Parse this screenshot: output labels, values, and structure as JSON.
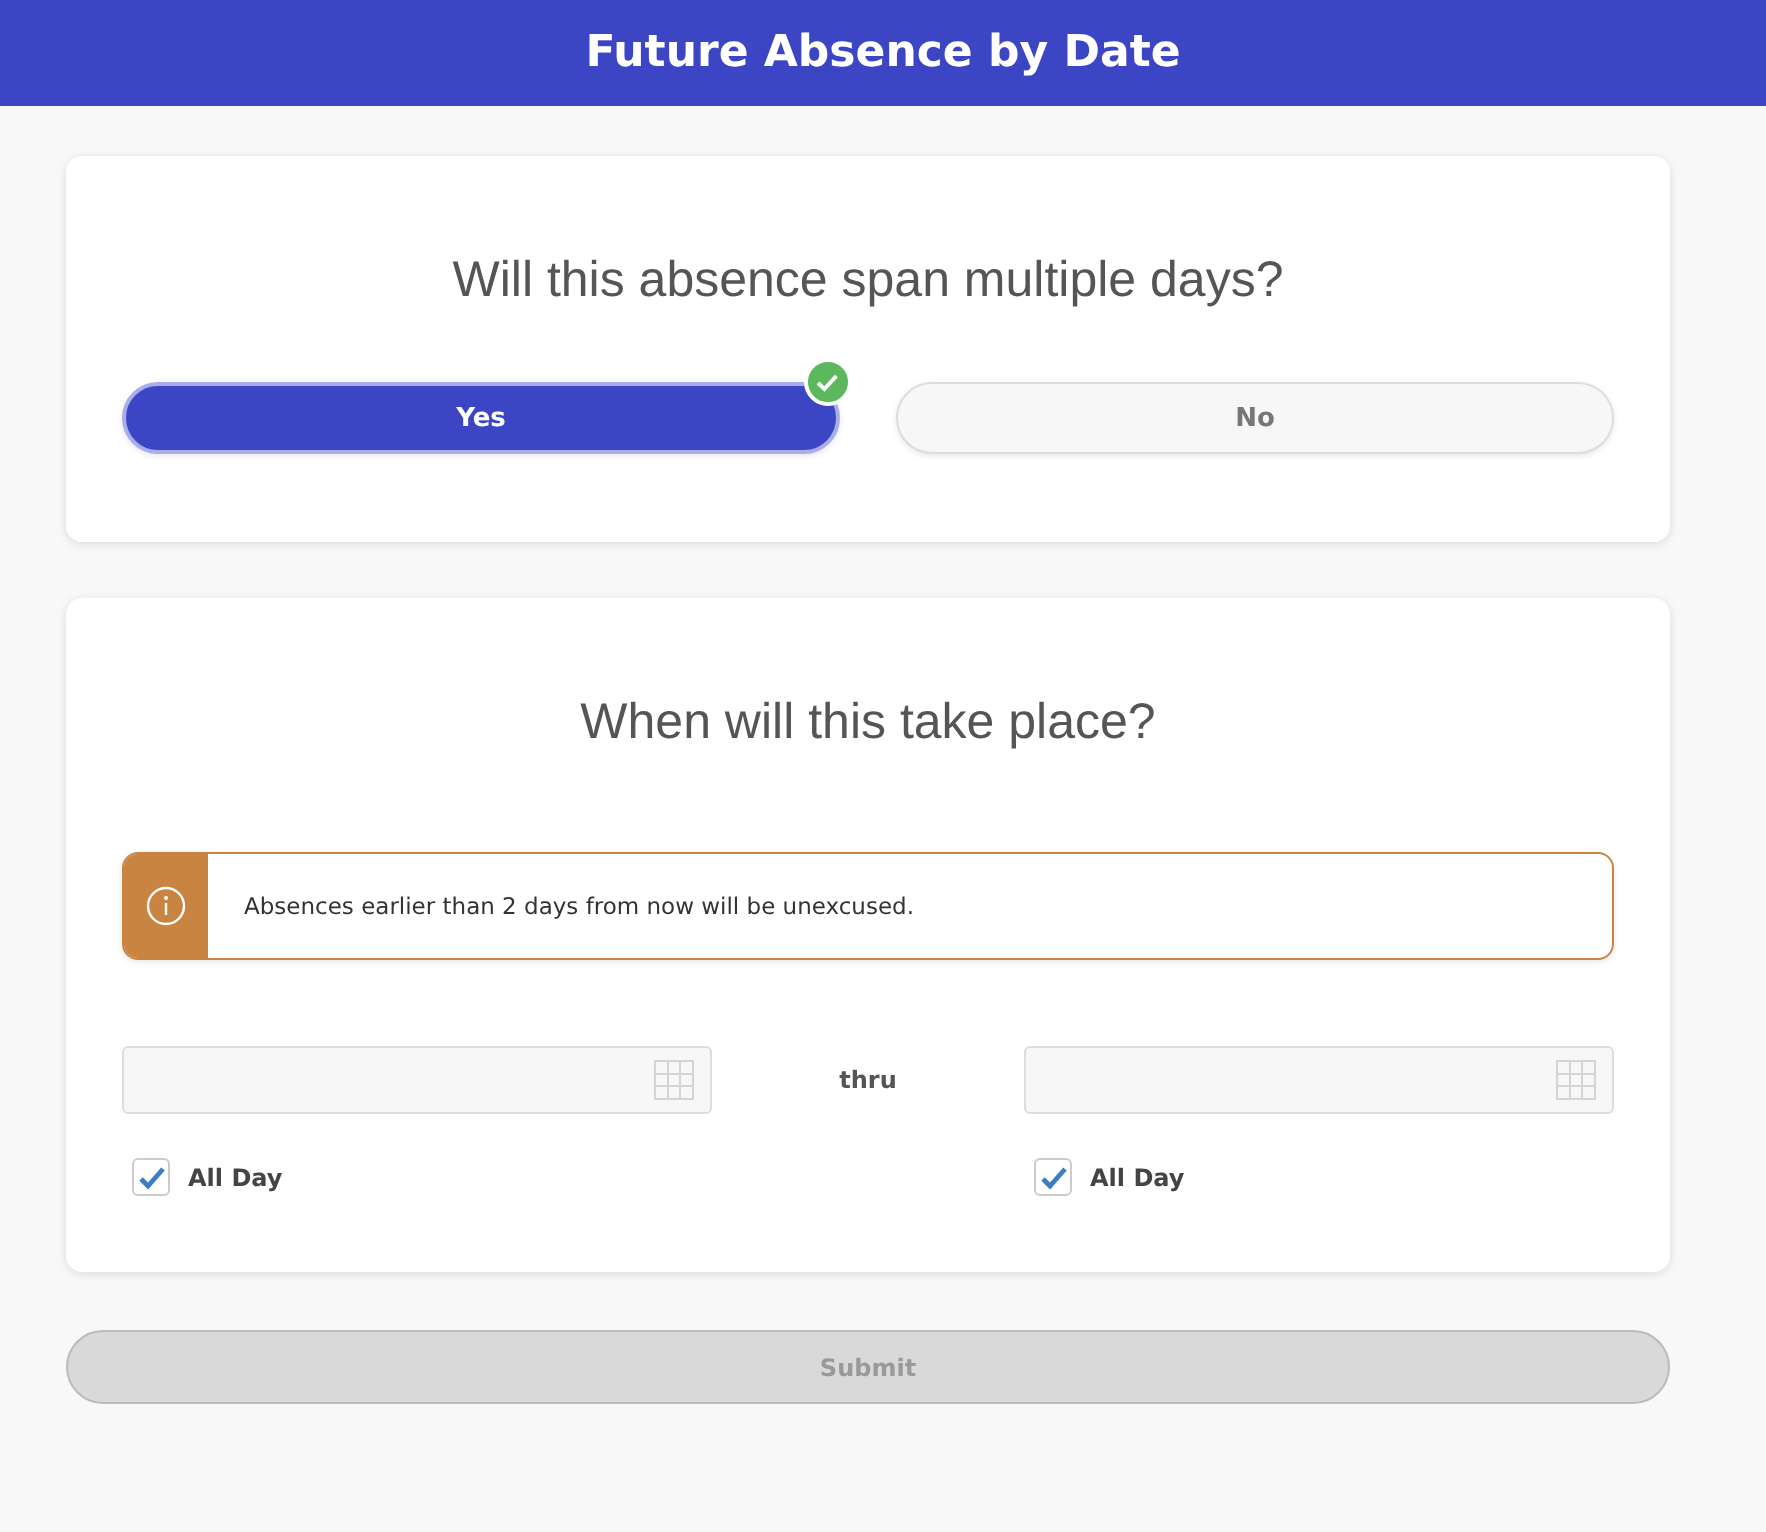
{
  "header": {
    "title": "Future Absence by Date"
  },
  "span_question": {
    "title": "Will this absence span multiple days?",
    "options": [
      {
        "label": "Yes",
        "selected": true
      },
      {
        "label": "No",
        "selected": false
      }
    ]
  },
  "when": {
    "title": "When will this take place?",
    "notice": {
      "text": "Absences earlier than 2 days from now will be unexcused."
    },
    "separator": "thru",
    "dates": [
      {
        "all_day": {
          "label": "All Day",
          "checked": true
        }
      },
      {
        "all_day": {
          "label": "All Day",
          "checked": true
        }
      }
    ]
  },
  "submit": {
    "label": "Submit",
    "disabled": true
  }
}
